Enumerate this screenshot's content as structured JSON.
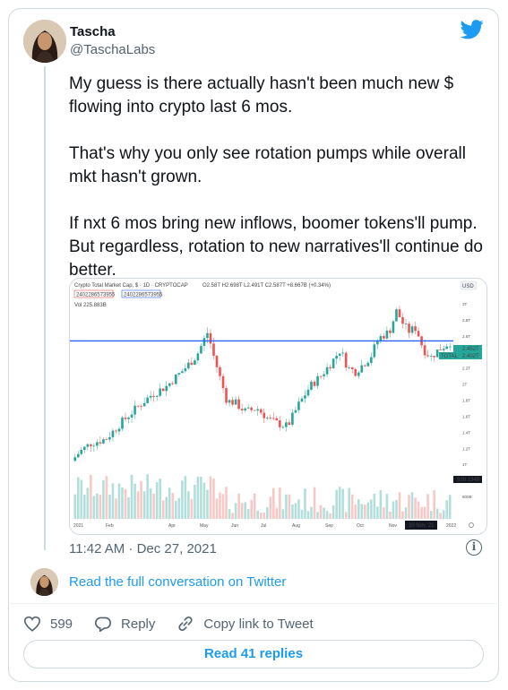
{
  "author": {
    "name": "Tascha",
    "handle": "@TaschaLabs"
  },
  "tweet": {
    "paragraphs": [
      "My guess is there actually hasn't been much new $ flowing into crypto last 6 mos.",
      "That's why you only see rotation pumps while overall mkt hasn't grown.",
      "If nxt 6 mos bring new inflows, boomer tokens'll pump. But regardless, rotation to new narratives'll continue do better."
    ],
    "timestamp": "11:42 AM · Dec 27, 2021"
  },
  "conversation_link": "Read the full conversation on Twitter",
  "actions": {
    "likes": "599",
    "reply": "Reply",
    "copy_link": "Copy link to Tweet"
  },
  "read_replies": "Read 41 replies",
  "chart": {
    "title": "Crypto Total Market Cap, $ · 1D · CRYPTOCAP",
    "ohlc": "O2.58T H2.698T L2.491T C2.587T +8.667B (+0.34%)",
    "box1": "2402286573955",
    "box2": "2402286573955",
    "vol": "Vol  225.883B",
    "currency": "USD",
    "y_ticks": [
      "3T",
      "2.8T",
      "2.6T",
      "2.4T",
      "2.2T",
      "2T",
      "1.8T",
      "1.6T",
      "1.4T",
      "1.2T",
      "1T",
      "800B",
      "600B"
    ],
    "x_ticks": [
      "2021",
      "Feb",
      "Apr",
      "May",
      "Jun",
      "Jul",
      "Aug",
      "Sep",
      "Oct",
      "Nov",
      "2022"
    ],
    "price_tag": "2.452T",
    "total_tag": "2.402T",
    "total_label": "TOTAL",
    "vol_tag": "928.134B",
    "cursor_date": "30 Nov '21",
    "colors": {
      "up": "#26a69a",
      "down": "#ef5350",
      "hline": "#2962ff"
    }
  }
}
